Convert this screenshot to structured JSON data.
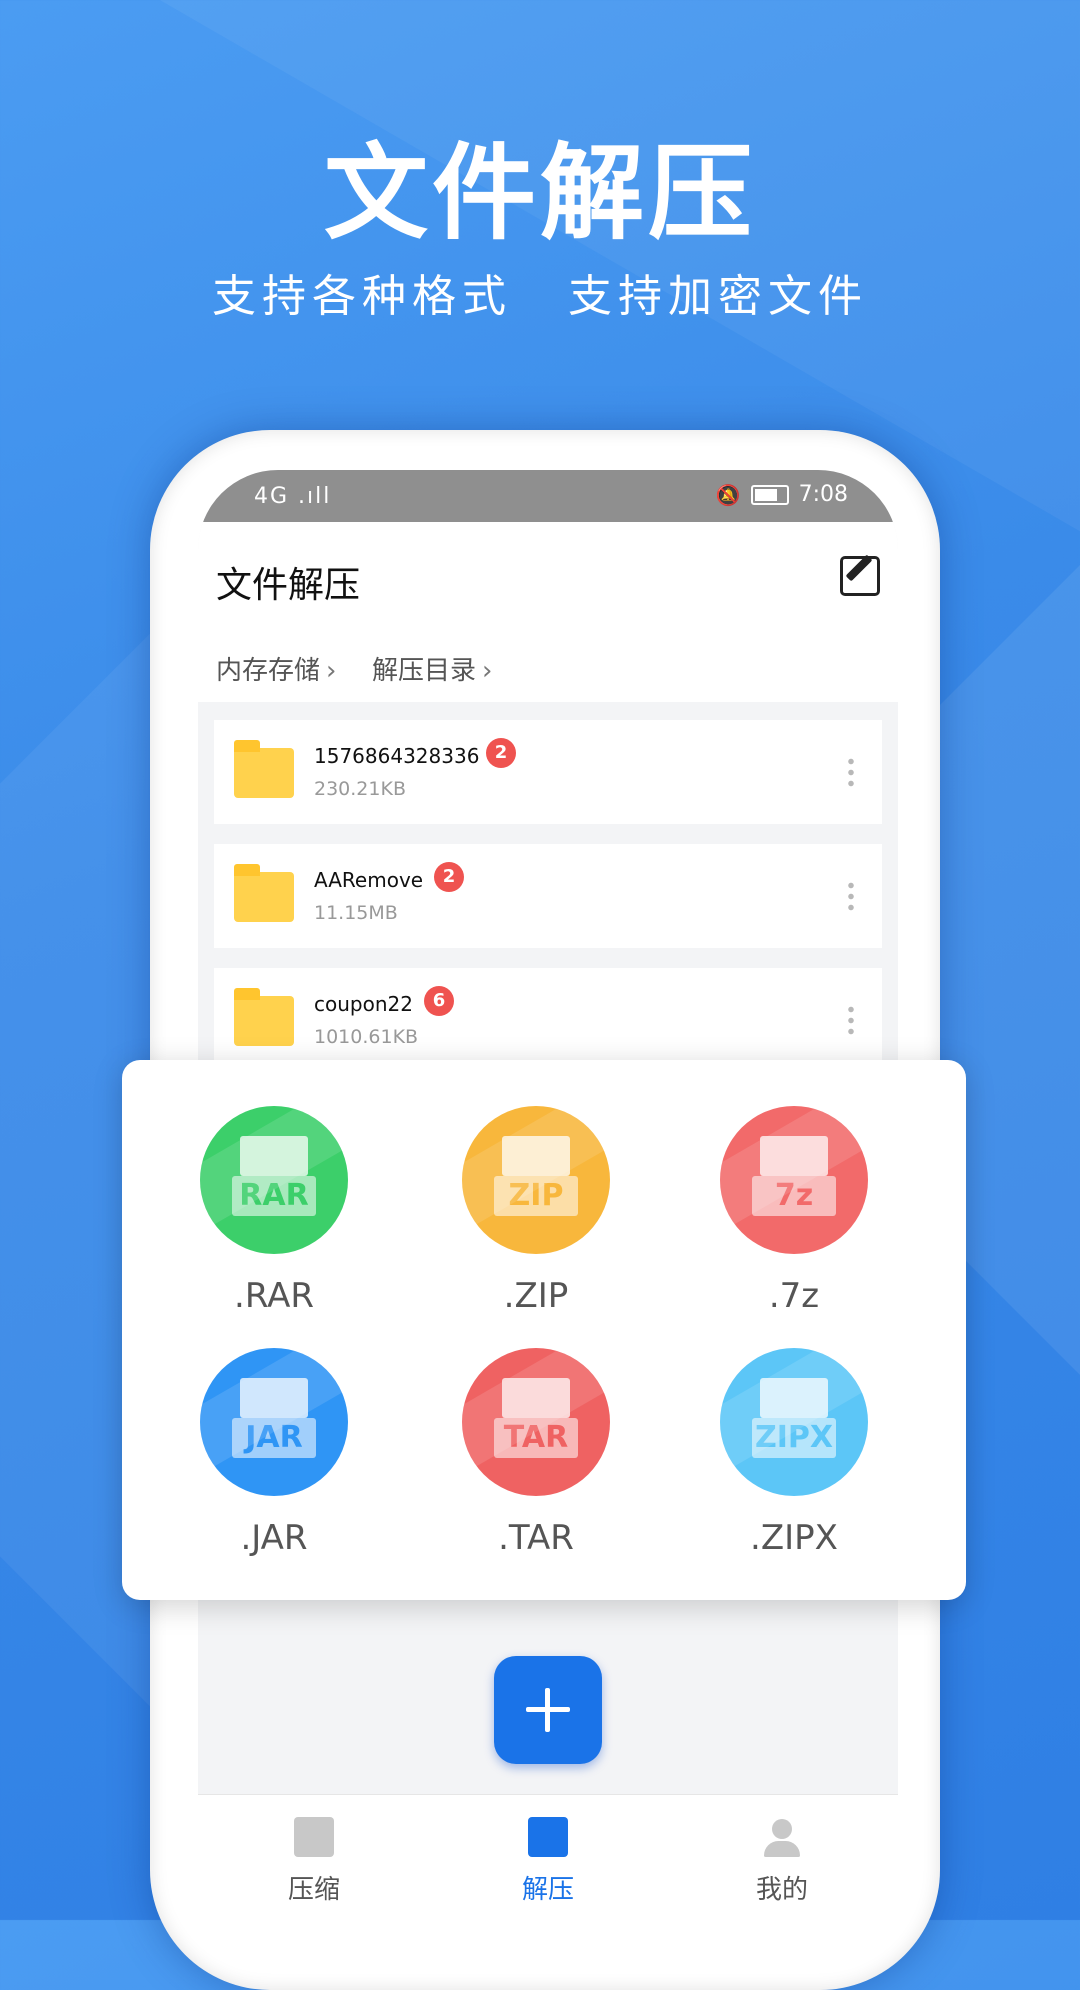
{
  "hero": {
    "title": "文件解压",
    "subtitle_1": "支持各种格式",
    "subtitle_2": "支持加密文件"
  },
  "status_bar": {
    "signal": "4G .ıll",
    "time": "7:08"
  },
  "app": {
    "title": "文件解压"
  },
  "breadcrumb": {
    "items": [
      "内存存储",
      "解压目录"
    ]
  },
  "files": [
    {
      "name": "1576864328336",
      "count": "2",
      "size": "230.21KB"
    },
    {
      "name": "AARemove",
      "count": "2",
      "size": "11.15MB"
    },
    {
      "name": "coupon22",
      "count": "6",
      "size": "1010.61KB"
    }
  ],
  "formats": [
    {
      "label": "RAR",
      "name": ".RAR",
      "color": "#3ccf6a"
    },
    {
      "label": "ZIP",
      "name": ".ZIP",
      "color": "#f8b73c"
    },
    {
      "label": "7z",
      "name": ".7z",
      "color": "#f26a6a"
    },
    {
      "label": "JAR",
      "name": ".JAR",
      "color": "#2f95f5"
    },
    {
      "label": "TAR",
      "name": ".TAR",
      "color": "#ef6262"
    },
    {
      "label": "ZIPX",
      "name": ".ZIPX",
      "color": "#5cc6f7"
    }
  ],
  "bottom_nav": {
    "compress": "压缩",
    "extract": "解压",
    "me": "我的",
    "active_color": "#1a73e8",
    "inactive_color": "#555555"
  }
}
